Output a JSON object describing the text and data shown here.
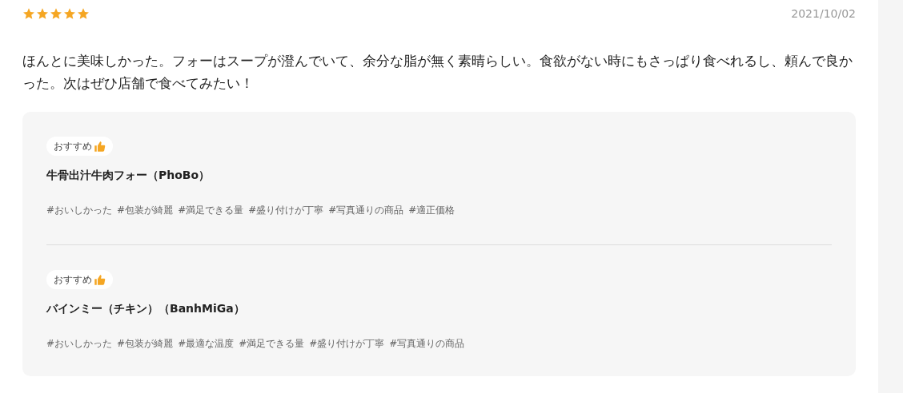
{
  "review": {
    "stars": 5,
    "date": "2021/10/02",
    "text": "ほんとに美味しかった。フォーはスープが澄んでいて、余分な脂が無く素晴らしい。食欲がない時にもさっぱり食べれるし、頼んで良かった。次はぜひ店舗で食べてみたい！"
  },
  "items": [
    {
      "badge": "おすすめ",
      "name": "牛骨出汁牛肉フォー（PhoBo）",
      "tags": [
        "#おいしかった",
        "#包装が綺麗",
        "#満足できる量",
        "#盛り付けが丁寧",
        "#写真通りの商品",
        "#適正価格"
      ]
    },
    {
      "badge": "おすすめ",
      "name": "バインミー（チキン）（BanhMiGa）",
      "tags": [
        "#おいしかった",
        "#包装が綺麗",
        "#最適な温度",
        "#満足できる量",
        "#盛り付けが丁寧",
        "#写真通りの商品"
      ]
    }
  ]
}
